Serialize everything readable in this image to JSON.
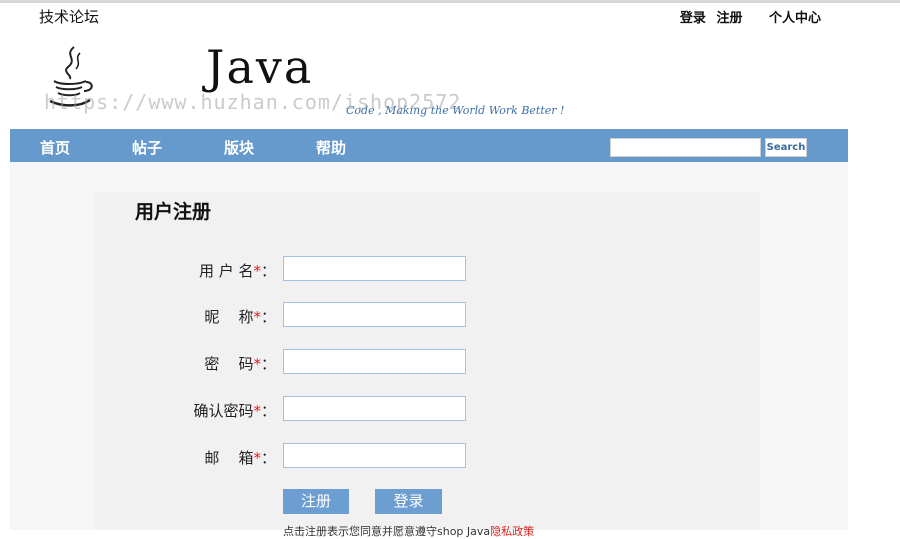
{
  "topbar": {
    "site_name": "技术论坛",
    "login": "登录",
    "register": "注册",
    "user_center": "个人中心"
  },
  "header": {
    "logo_text": "Java",
    "slogan": "Code , Making the World Work Better !",
    "watermark": "https://www.huzhan.com/ishop2572"
  },
  "nav": {
    "items": [
      "首页",
      "帖子",
      "版块",
      "帮助"
    ],
    "search_label": "Search",
    "search_value": ""
  },
  "form": {
    "title": "用户注册",
    "required_mark": "*",
    "fields": [
      {
        "label": "用 户 名",
        "value": ""
      },
      {
        "label": "昵    称",
        "value": ""
      },
      {
        "label": "密    码",
        "value": ""
      },
      {
        "label": "确认密码",
        "value": ""
      },
      {
        "label": "邮    箱",
        "value": ""
      }
    ],
    "register_button": "注册",
    "login_button": "登录",
    "agreement_text": "点击注册表示您同意并愿意遵守shop Java",
    "agreement_link": "隐私政策"
  },
  "colors": {
    "nav_bg": "#6699cc",
    "button_bg": "#6c9ed1",
    "required": "#e02020",
    "field_border": "#9ec3e6",
    "slogan": "#3b6fa8"
  }
}
